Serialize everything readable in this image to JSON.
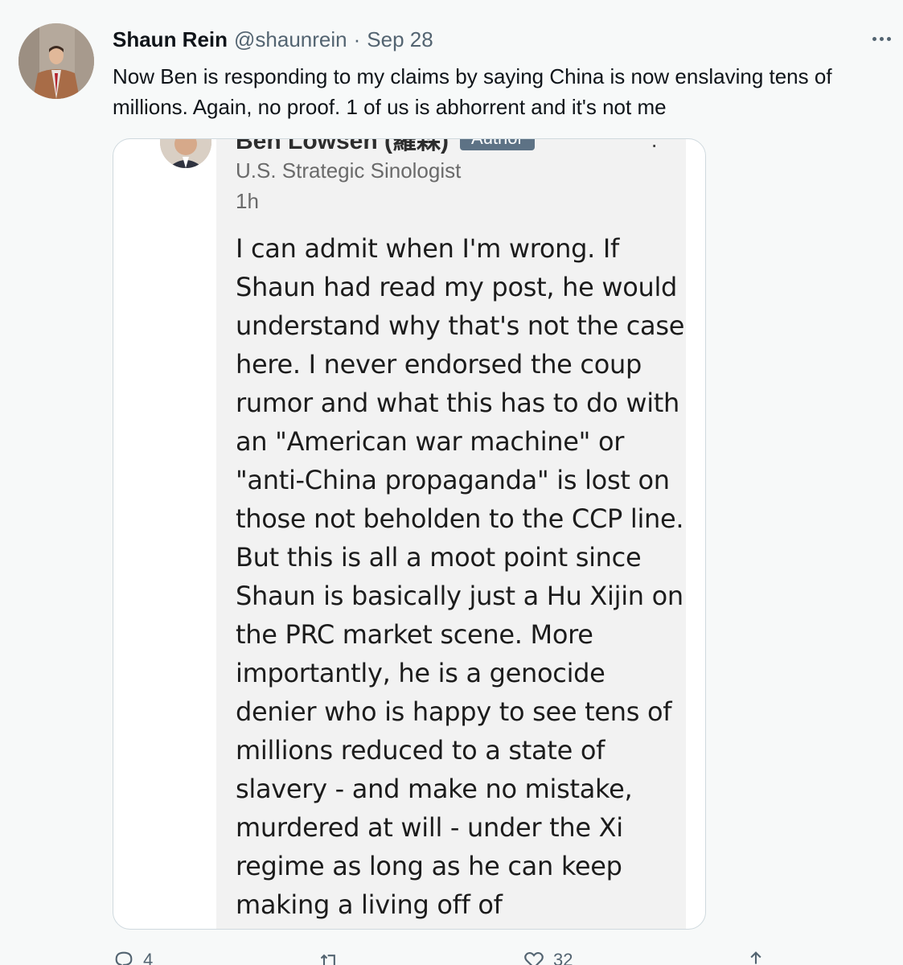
{
  "tweet": {
    "display_name": "Shaun Rein",
    "handle": "@shaunrein",
    "separator": "·",
    "date": "Sep 28",
    "text": "Now Ben is responding to my claims by saying China is now enslaving tens of millions. Again, no proof. 1 of us is abhorrent and it's not me"
  },
  "card": {
    "name": "Ben Lowsen (羅森)",
    "badge": "Author",
    "title": "U.S. Strategic Sinologist",
    "time": "1h",
    "body": "I can admit when I'm wrong. If Shaun had read my post, he would understand why that's not the case here. I never endorsed the coup rumor and what this has to do with an \"American war machine\" or \"anti-China propaganda\" is lost on those not beholden to the CCP line. But this is all a moot point since Shaun is basically just a Hu Xijin on the PRC market scene. More importantly, he is a genocide denier who is happy to see tens of millions reduced to a state of slavery - and make no mistake, murdered at will - under the Xi regime as long as he can keep making a living off of"
  },
  "actions": {
    "reply_count": "4",
    "retweet_count": "",
    "like_count": "32"
  },
  "icons": {
    "reply": "reply-icon",
    "retweet": "retweet-icon",
    "like": "heart-icon",
    "share": "share-icon",
    "more": "more-icon"
  },
  "colors": {
    "background": "#f7f9f9",
    "secondary_text": "#536471",
    "badge": "#5d7285"
  }
}
